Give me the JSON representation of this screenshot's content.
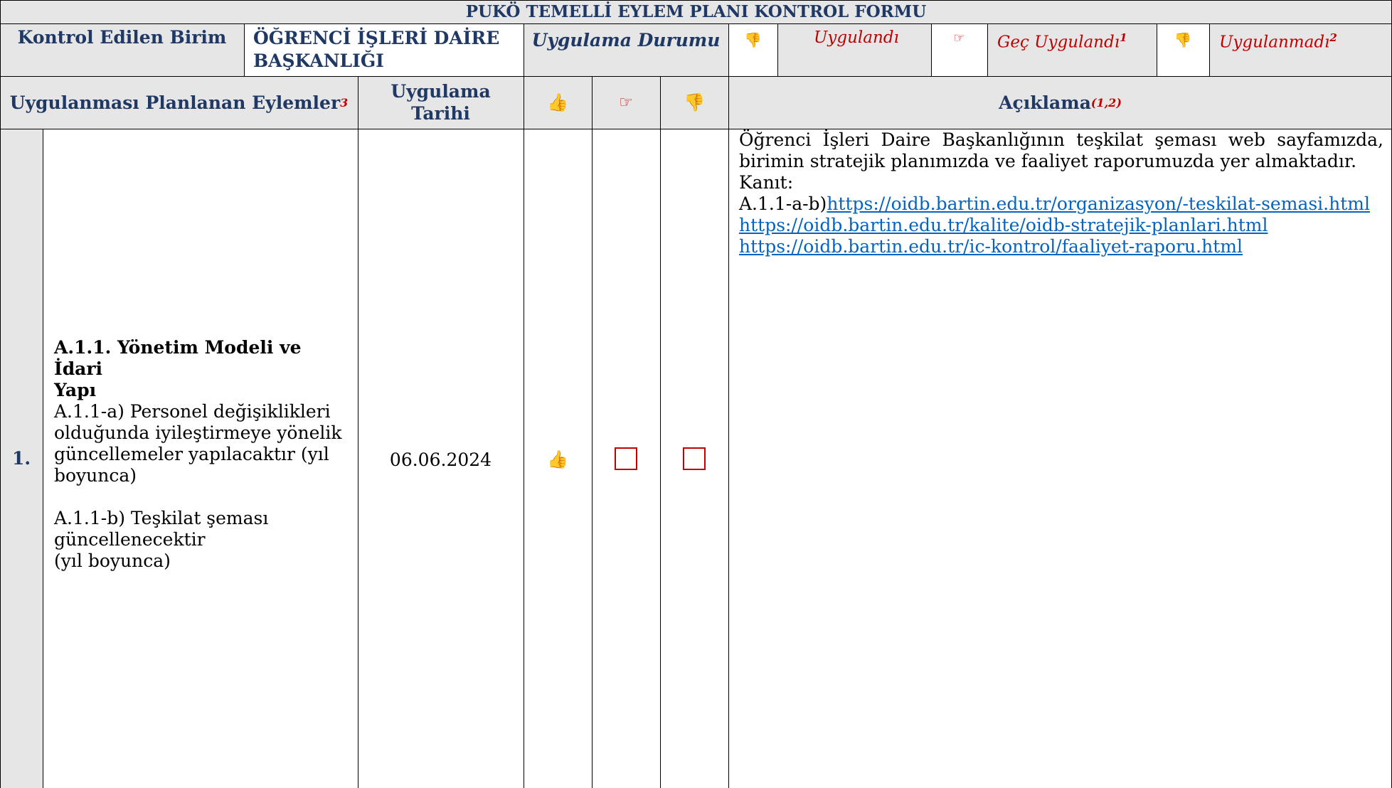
{
  "form": {
    "title": "PUKÖ TEMELLİ EYLEM PLANI KONTROL FORMU",
    "unit_label": "Kontrol Edilen Birim",
    "unit_value_line1": "ÖĞRENCİ İŞLERİ DAİRE",
    "unit_value_line2": "BAŞKANLIĞI",
    "status_label": "Uygulama Durumu",
    "legend": {
      "applied": "Uygulandı",
      "late": "Geç Uygulandı",
      "late_sup": "1",
      "not_applied": "Uygulanmadı",
      "not_applied_sup": "2"
    }
  },
  "headers": {
    "actions": "Uygulanması Planlanan Eylemler",
    "actions_sup": "3",
    "date_line1": "Uygulama",
    "date_line2": "Tarihi",
    "explanation": "Açıklama",
    "explanation_sup": "(1,2)"
  },
  "icons": {
    "thumbs_up": "thumbs-up-icon",
    "pointing_hand": "pointing-hand-icon",
    "thumbs_down": "thumbs-down-icon"
  },
  "rows": [
    {
      "number": "1.",
      "heading_line1": "A.1.1. Yönetim Modeli ve İdari",
      "heading_line2": "Yapı",
      "item_a": "A.1.1-a) Personel değişiklikleri olduğunda iyileştirmeye yönelik güncellemeler yapılacaktır (yıl boyunca)",
      "item_b_line1": "A.1.1-b) Teşkilat şeması",
      "item_b_line2": "güncellenecektir",
      "item_b_line3": "(yıl boyunca)",
      "date": "06.06.2024",
      "status": "Uygulandı",
      "explanation": "Öğrenci İşleri Daire Başkanlığının teşkilat şeması web sayfamızda, birimin stratejik planımızda ve faaliyet raporumuzda yer almaktadır.",
      "evidence_label": "Kanıt:",
      "evidence_prefix": "A.1.1-a-b)",
      "links": [
        "https://oidb.bartin.edu.tr/organizasyon/-teskilat-semasi.html",
        "https://oidb.bartin.edu.tr/kalite/oidb-stratejik-planlari.html",
        "https://oidb.bartin.edu.tr/ic-kontrol/faaliyet-raporu.html"
      ]
    }
  ]
}
